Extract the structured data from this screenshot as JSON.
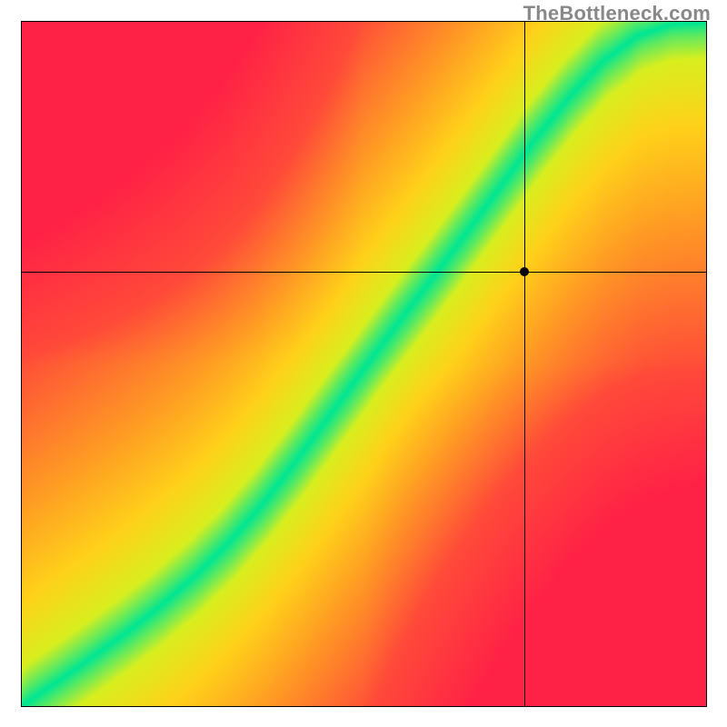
{
  "watermark": "TheBottleneck.com",
  "chart_data": {
    "type": "heatmap",
    "title": "",
    "xlabel": "",
    "ylabel": "",
    "xlim": [
      0,
      1
    ],
    "ylim": [
      0,
      1
    ],
    "marker": {
      "x": 0.735,
      "y": 0.635
    },
    "crosshair": {
      "x": 0.735,
      "y": 0.635
    },
    "ideal_curve_samples": {
      "description": "Approximate x→y mapping of the green optimal band centerline (normalized 0..1, y measured from bottom)",
      "x": [
        0.0,
        0.05,
        0.1,
        0.15,
        0.2,
        0.25,
        0.3,
        0.35,
        0.4,
        0.45,
        0.5,
        0.55,
        0.6,
        0.65,
        0.7,
        0.75,
        0.8,
        0.85,
        0.9,
        0.95,
        1.0
      ],
      "y": [
        0.0,
        0.034,
        0.069,
        0.105,
        0.144,
        0.187,
        0.236,
        0.293,
        0.357,
        0.425,
        0.493,
        0.56,
        0.625,
        0.692,
        0.76,
        0.828,
        0.89,
        0.943,
        0.98,
        0.997,
        1.0
      ]
    },
    "colorscale": {
      "description": "distance from ideal curve → color",
      "stops": [
        {
          "d": 0.0,
          "color": "#00e694"
        },
        {
          "d": 0.07,
          "color": "#d9ef1f"
        },
        {
          "d": 0.18,
          "color": "#ffd21a"
        },
        {
          "d": 0.35,
          "color": "#ff9925"
        },
        {
          "d": 0.6,
          "color": "#ff4a3a"
        },
        {
          "d": 1.0,
          "color": "#ff2247"
        }
      ]
    }
  }
}
